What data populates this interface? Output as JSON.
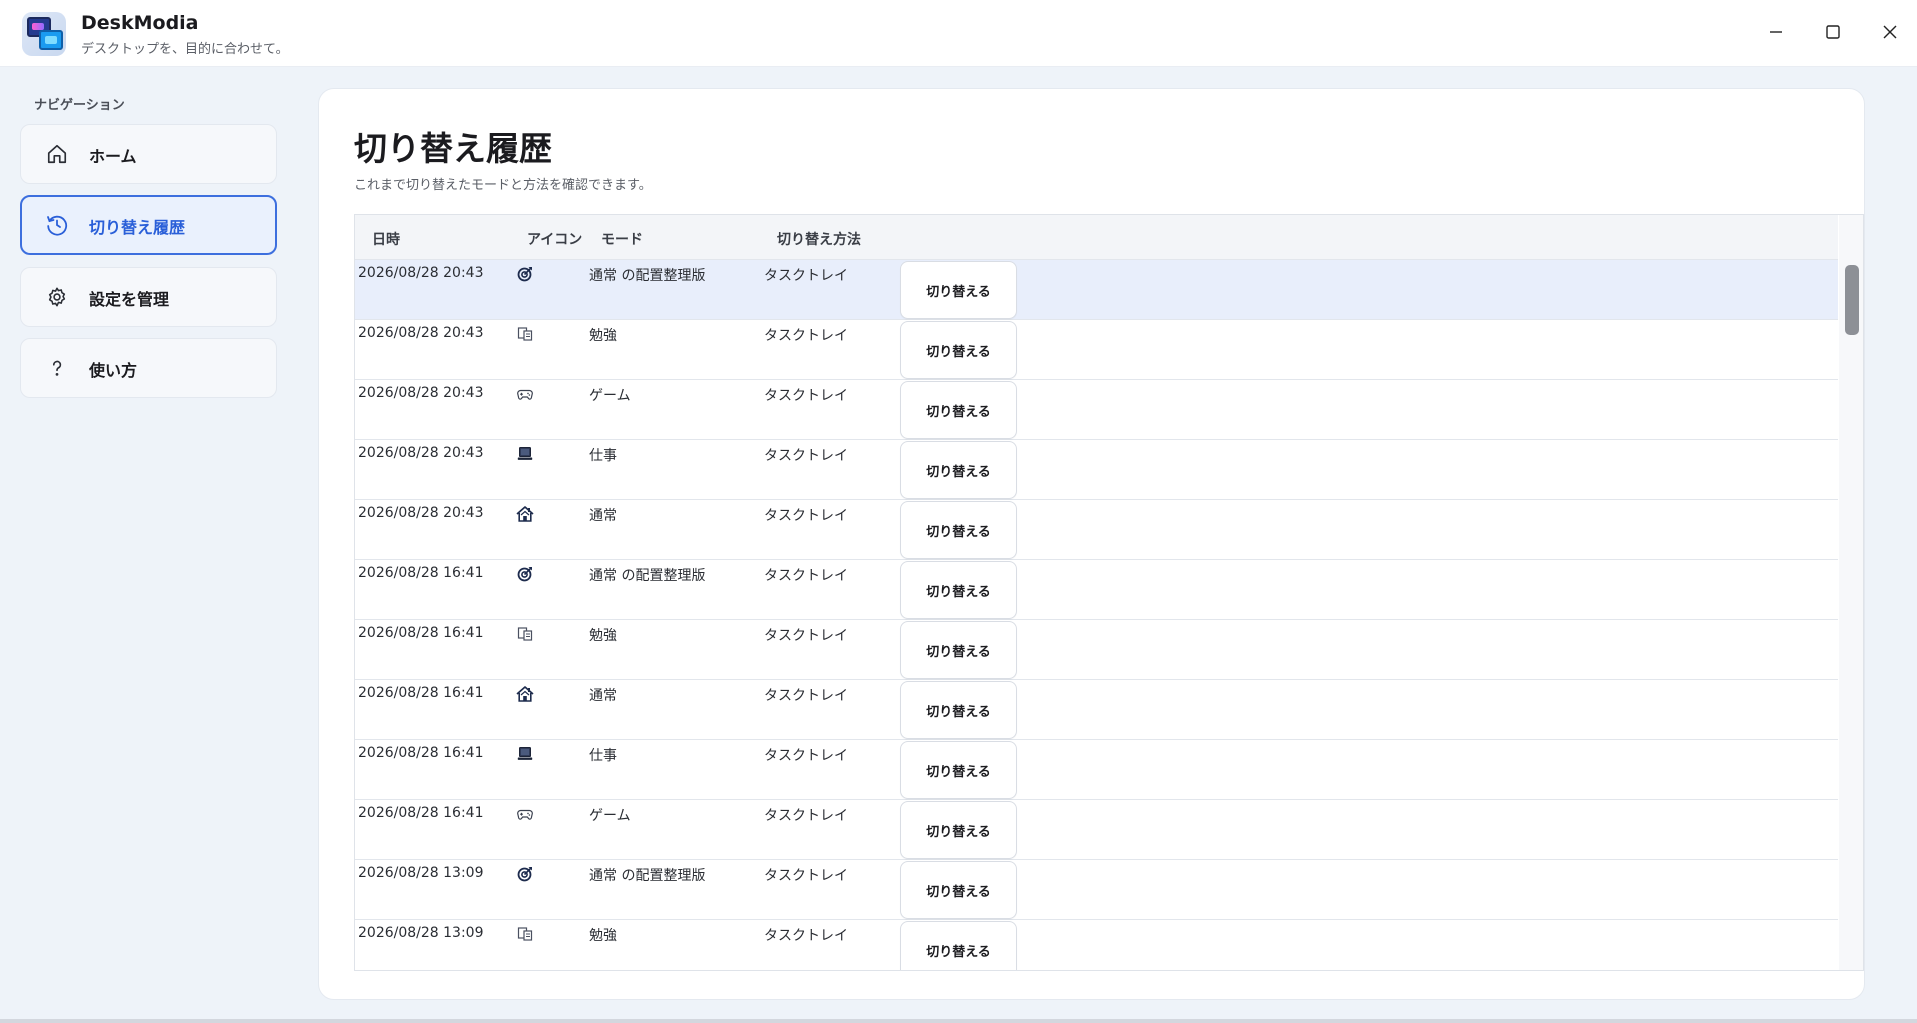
{
  "app": {
    "title": "DeskModia",
    "subtitle": "デスクトップを、目的に合わせて。"
  },
  "window_controls": {
    "minimize_icon": "minimize-icon",
    "maximize_icon": "maximize-icon",
    "close_icon": "close-icon"
  },
  "sidebar": {
    "heading": "ナビゲーション",
    "items": [
      {
        "label": "ホーム",
        "icon": "home-icon",
        "active": false
      },
      {
        "label": "切り替え履歴",
        "icon": "history-icon",
        "active": true
      },
      {
        "label": "設定を管理",
        "icon": "gear-icon",
        "active": false
      },
      {
        "label": "使い方",
        "icon": "question-icon",
        "active": false
      }
    ]
  },
  "page": {
    "title": "切り替え履歴",
    "description": "これまで切り替えたモードと方法を確認できます。"
  },
  "table": {
    "columns": [
      "日時",
      "アイコン",
      "モード",
      "切り替え方法"
    ],
    "button_label": "切り替える",
    "rows": [
      {
        "datetime": "2026/08/28 20:43",
        "icon": "target-icon",
        "mode": "通常 の配置整理版",
        "method": "タスクトレイ"
      },
      {
        "datetime": "2026/08/28 20:43",
        "icon": "book-icon",
        "mode": "勉強",
        "method": "タスクトレイ"
      },
      {
        "datetime": "2026/08/28 20:43",
        "icon": "gamepad-icon",
        "mode": "ゲーム",
        "method": "タスクトレイ"
      },
      {
        "datetime": "2026/08/28 20:43",
        "icon": "laptop-icon",
        "mode": "仕事",
        "method": "タスクトレイ"
      },
      {
        "datetime": "2026/08/28 20:43",
        "icon": "house-icon",
        "mode": "通常",
        "method": "タスクトレイ"
      },
      {
        "datetime": "2026/08/28 16:41",
        "icon": "target-icon",
        "mode": "通常 の配置整理版",
        "method": "タスクトレイ"
      },
      {
        "datetime": "2026/08/28 16:41",
        "icon": "book-icon",
        "mode": "勉強",
        "method": "タスクトレイ"
      },
      {
        "datetime": "2026/08/28 16:41",
        "icon": "house-icon",
        "mode": "通常",
        "method": "タスクトレイ"
      },
      {
        "datetime": "2026/08/28 16:41",
        "icon": "laptop-icon",
        "mode": "仕事",
        "method": "タスクトレイ"
      },
      {
        "datetime": "2026/08/28 16:41",
        "icon": "gamepad-icon",
        "mode": "ゲーム",
        "method": "タスクトレイ"
      },
      {
        "datetime": "2026/08/28 13:09",
        "icon": "target-icon",
        "mode": "通常 の配置整理版",
        "method": "タスクトレイ"
      },
      {
        "datetime": "2026/08/28 13:09",
        "icon": "book-icon",
        "mode": "勉強",
        "method": "タスクトレイ"
      }
    ],
    "selected_row": 0
  },
  "colors": {
    "accent": "#3d6fde",
    "sidebar_bg": "#eef3f9",
    "selected_row_bg": "#e8eefb"
  }
}
